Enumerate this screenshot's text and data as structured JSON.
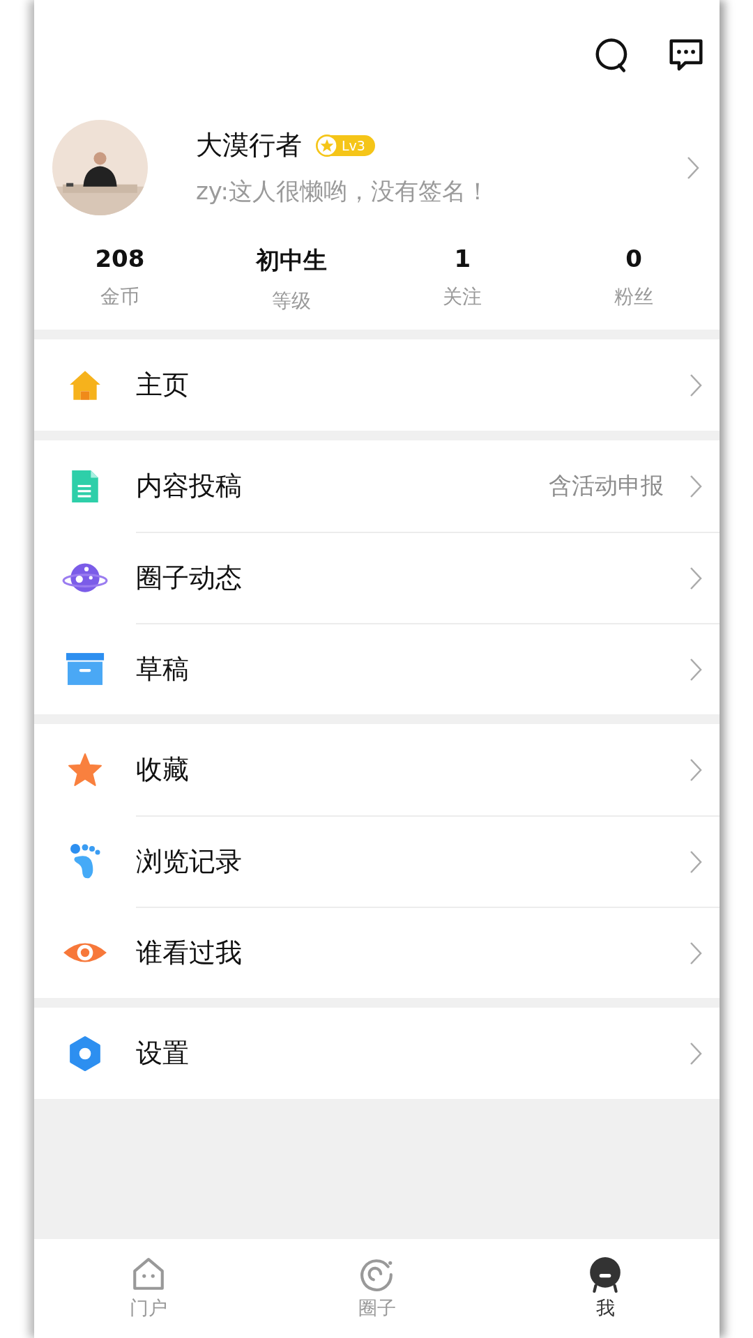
{
  "profile": {
    "name": "大漠行者",
    "level_badge": "Lv3",
    "signature": "zy:这人很懒哟，没有签名！"
  },
  "stats": [
    {
      "value": "208",
      "label": "金币"
    },
    {
      "value": "初中生",
      "label": "等级"
    },
    {
      "value": "1",
      "label": "关注"
    },
    {
      "value": "0",
      "label": "粉丝"
    }
  ],
  "menu_groups": [
    [
      {
        "kind": "home",
        "label": "主页"
      }
    ],
    [
      {
        "kind": "document",
        "label": "内容投稿",
        "hint": "含活动申报"
      },
      {
        "kind": "planet",
        "label": "圈子动态"
      },
      {
        "kind": "box",
        "label": "草稿"
      }
    ],
    [
      {
        "kind": "star",
        "label": "收藏"
      },
      {
        "kind": "footprint",
        "label": "浏览记录"
      },
      {
        "kind": "eye",
        "label": "谁看过我"
      }
    ],
    [
      {
        "kind": "gear",
        "label": "设置"
      }
    ]
  ],
  "tabs": [
    {
      "kind": "portal",
      "label": "门户",
      "selected": false
    },
    {
      "kind": "circle",
      "label": "圈子",
      "selected": false
    },
    {
      "kind": "me",
      "label": "我",
      "selected": true
    }
  ]
}
